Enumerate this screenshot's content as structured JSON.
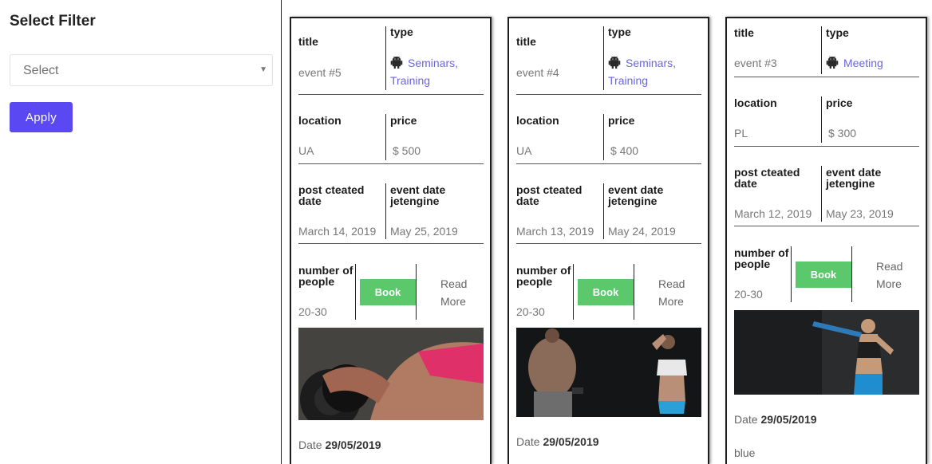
{
  "sidebar": {
    "title": "Select Filter",
    "select": {
      "value": "Select"
    },
    "apply_label": "Apply"
  },
  "labels": {
    "title": "title",
    "type": "type",
    "location": "location",
    "price": "price",
    "post_created": "post cteated date",
    "event_date": "event date jetengine",
    "people": "number of people",
    "book": "Book",
    "read_more": "Read More",
    "date_prefix": "Date"
  },
  "events": [
    {
      "title": "event #5",
      "type": "Seminars, Training",
      "location": "UA",
      "price": "$ 500",
      "post_created": "March 14, 2019",
      "event_date": "May 25, 2019",
      "people": "20-30",
      "date": "29/05/2019",
      "extra": ""
    },
    {
      "title": "event #4",
      "type": "Seminars, Training",
      "location": "UA",
      "price": "$ 400",
      "post_created": "March 13, 2019",
      "event_date": "May 24, 2019",
      "people": "20-30",
      "date": "29/05/2019",
      "extra": ""
    },
    {
      "title": "event #3",
      "type": "Meeting",
      "location": "PL",
      "price": "$ 300",
      "post_created": "March 12, 2019",
      "event_date": "May 23, 2019",
      "people": "20-30",
      "date": "29/05/2019",
      "extra": "blue"
    }
  ],
  "colors": {
    "accent": "#5a48f2",
    "book": "#5bc96b",
    "link": "#6b66e0"
  }
}
